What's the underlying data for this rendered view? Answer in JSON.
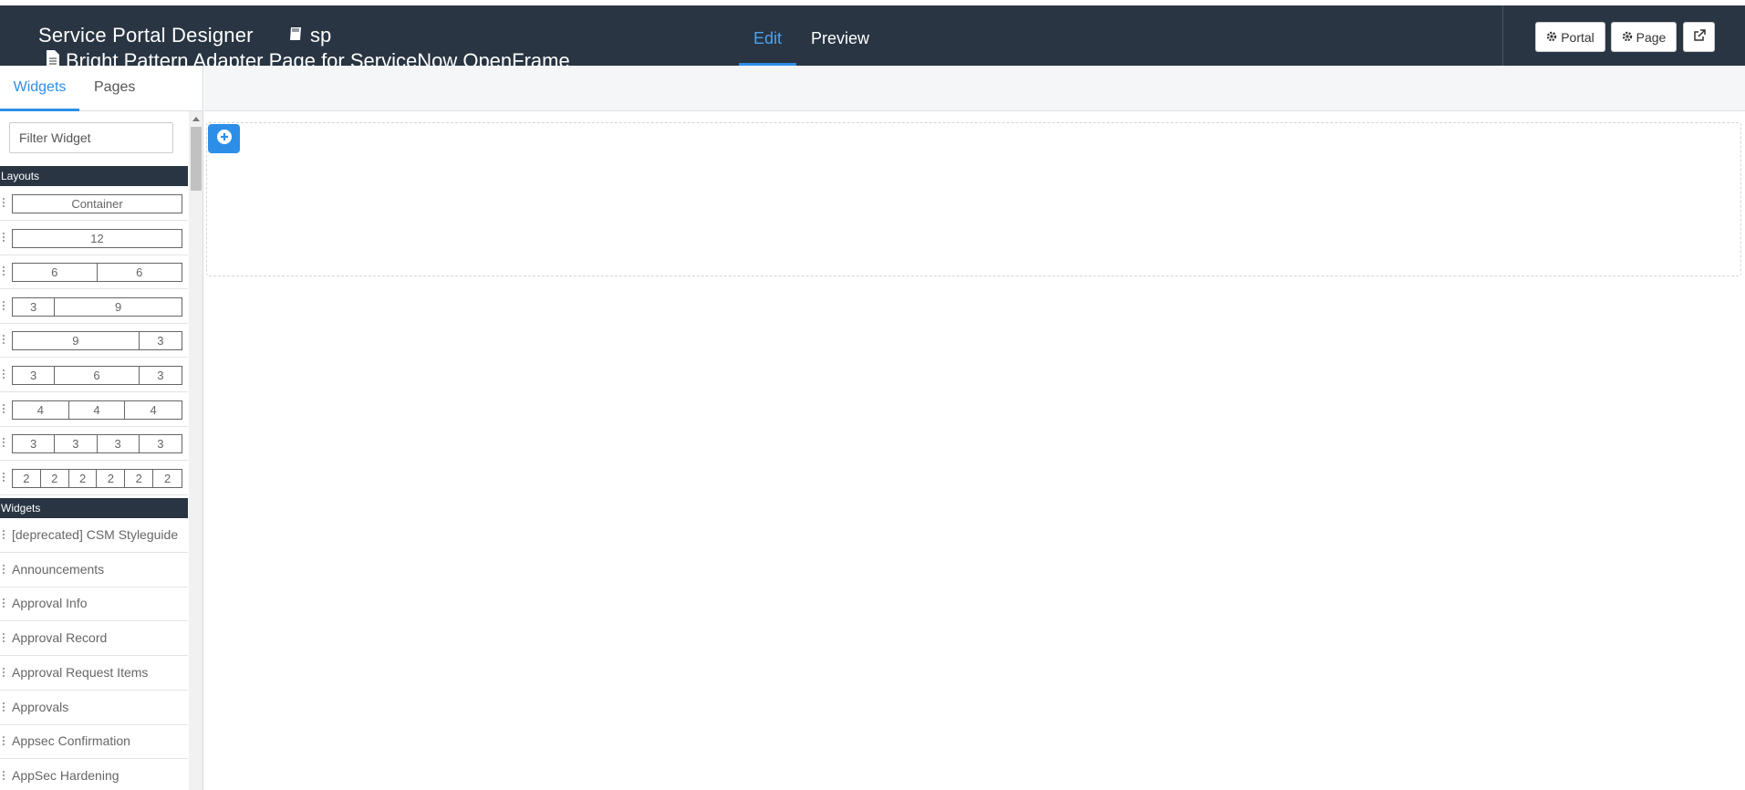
{
  "header": {
    "title": "Service Portal Designer",
    "portal_name": "sp",
    "page_name": "Bright Pattern Adapter Page for ServiceNow OpenFrame",
    "tabs": {
      "edit": "Edit",
      "preview": "Preview"
    },
    "buttons": {
      "portal": "Portal",
      "page": "Page"
    },
    "active_tab_color": "#2d8ee8",
    "bg_color": "#293542"
  },
  "sidebar": {
    "tabs": {
      "widgets": "Widgets",
      "pages": "Pages"
    },
    "filter_placeholder": "Filter Widget",
    "layouts_heading": "Layouts",
    "layouts": [
      [
        "Container"
      ],
      [
        "12"
      ],
      [
        "6",
        "6"
      ],
      [
        "3",
        "9"
      ],
      [
        "9",
        "3"
      ],
      [
        "3",
        "6",
        "3"
      ],
      [
        "4",
        "4",
        "4"
      ],
      [
        "3",
        "3",
        "3",
        "3"
      ],
      [
        "2",
        "2",
        "2",
        "2",
        "2",
        "2"
      ]
    ],
    "widgets_heading": "Widgets",
    "widgets": [
      "[deprecated] CSM Styleguide",
      "Announcements",
      "Approval Info",
      "Approval Record",
      "Approval Request Items",
      "Approvals",
      "Appsec Confirmation",
      "AppSec Hardening"
    ]
  },
  "canvas": {
    "add_icon": "plus-circle-icon"
  }
}
